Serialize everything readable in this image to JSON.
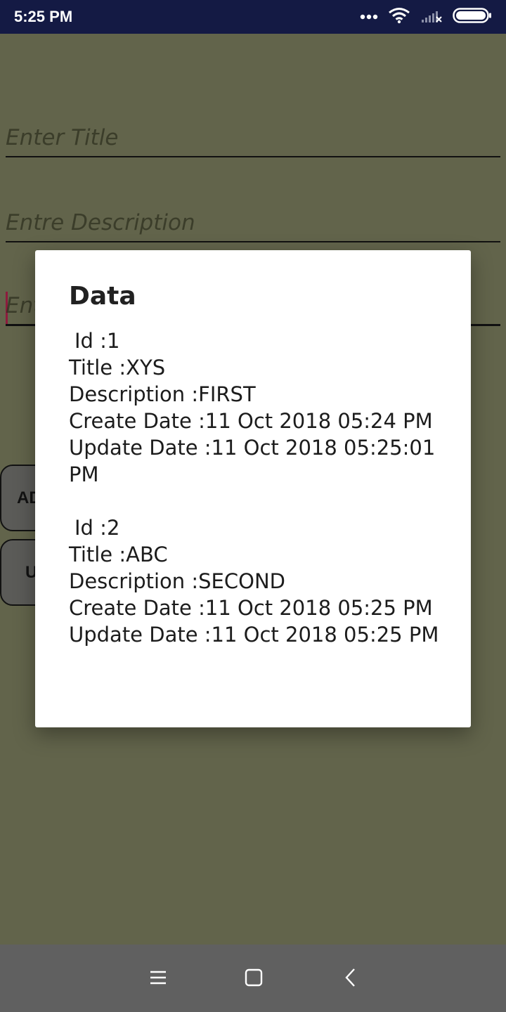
{
  "status_bar": {
    "time": "5:25 PM",
    "icons": [
      "more-dots-icon",
      "wifi-icon",
      "signal-icon",
      "battery-icon"
    ]
  },
  "form": {
    "title_placeholder": "Enter Title",
    "description_placeholder": "Entre Description",
    "date_placeholder": "Ent"
  },
  "buttons": {
    "add_label": "AD",
    "update_label": "U"
  },
  "dialog": {
    "title": "Data",
    "records": [
      {
        "id": "Id :1",
        "title": "Title :XYS",
        "description": "Description :FIRST",
        "create_date": "Create Date :11 Oct 2018 05:24 PM",
        "update_date": "Update Date :11 Oct 2018 05:25:01 PM"
      },
      {
        "id": "Id :2",
        "title": "Title :ABC",
        "description": "Description :SECOND",
        "create_date": "Create Date :11 Oct 2018 05:25 PM",
        "update_date": "Update Date :11 Oct 2018 05:25 PM"
      }
    ]
  },
  "nav_bar": {
    "icons": [
      "menu-icon",
      "home-icon",
      "back-icon"
    ]
  },
  "colors": {
    "status_bar": "#141a44",
    "scrim_background": "#62644b",
    "dialog": "#ffffff",
    "nav_bar": "#606060",
    "cursor": "#8d1b3d"
  }
}
